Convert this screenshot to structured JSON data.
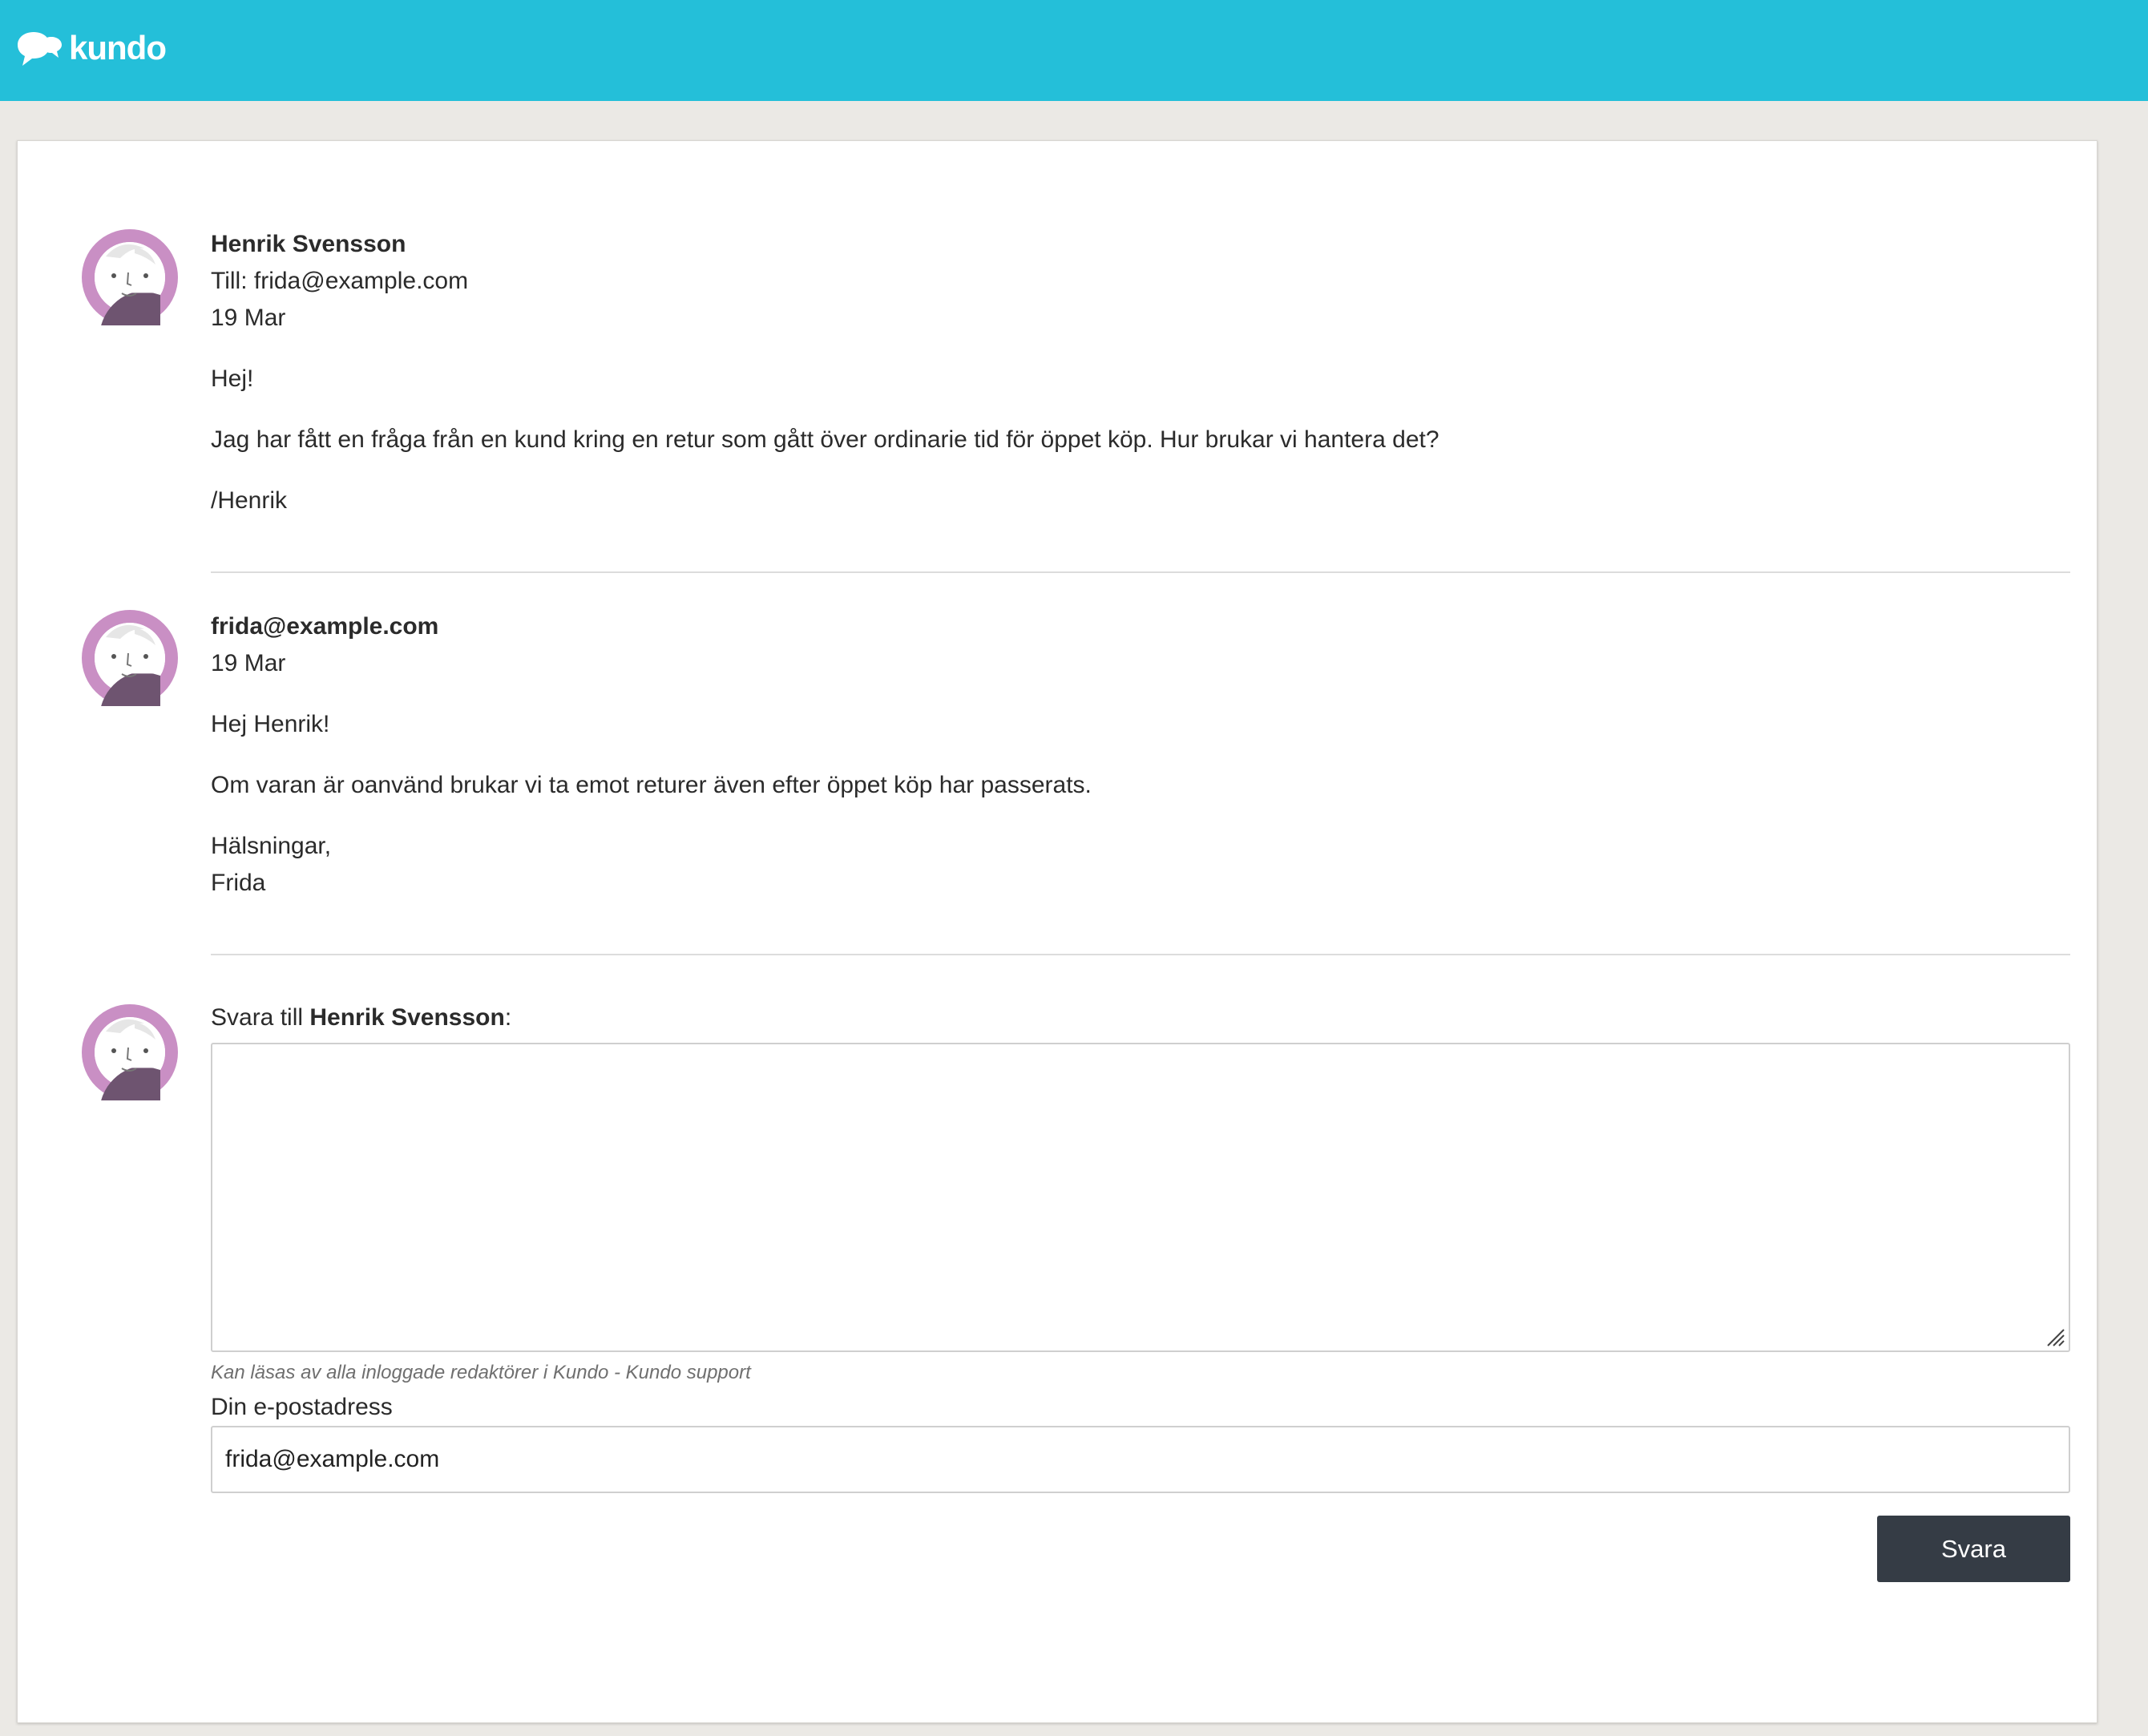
{
  "header": {
    "logo_text": "kundo",
    "brand_color": "#24bfd9"
  },
  "messages": [
    {
      "author": "Henrik Svensson",
      "to_line": "Till: frida@example.com",
      "date": "19 Mar",
      "paragraphs": [
        "Hej!",
        "Jag har fått en fråga från en kund kring en retur som gått över ordinarie tid för öppet köp. Hur brukar vi hantera det?",
        "/Henrik"
      ]
    },
    {
      "author": "frida@example.com",
      "date": "19 Mar",
      "paragraphs": [
        "Hej Henrik!",
        "Om varan är oanvänd brukar vi ta emot returer även efter öppet köp har passerats."
      ],
      "closing_line1": "Hälsningar,",
      "closing_line2": "Frida"
    }
  ],
  "reply": {
    "label_prefix": "Svara till ",
    "recipient": "Henrik Svensson",
    "label_suffix": ":",
    "textarea_value": "",
    "visibility_hint": "Kan läsas av alla inloggade redaktörer i Kundo - Kundo support",
    "email_label": "Din e-postadress",
    "email_value": "frida@example.com",
    "submit_label": "Svara",
    "submit_color": "#353c45"
  },
  "avatar": {
    "ring_color": "#c98fc4",
    "icon": "user-avatar-icon"
  }
}
